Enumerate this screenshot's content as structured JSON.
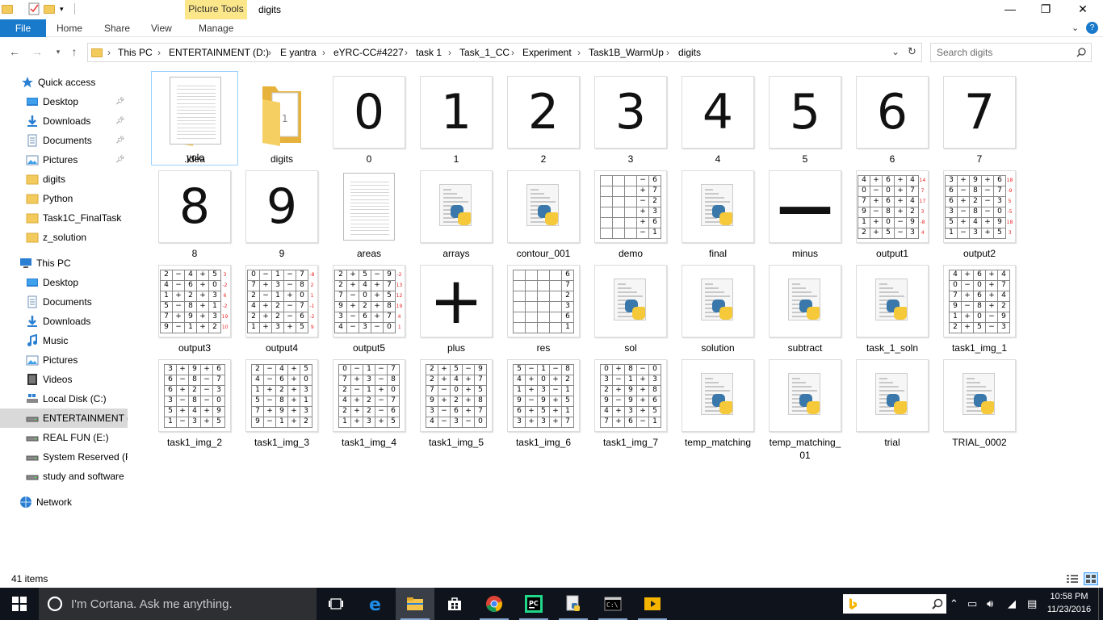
{
  "window": {
    "title": "digits",
    "contextual_tab_group": "Picture Tools",
    "controls": {
      "minimize": "—",
      "restore": "❐",
      "close": "✕"
    }
  },
  "ribbon": {
    "tabs": [
      "File",
      "Home",
      "Share",
      "View",
      "Manage"
    ],
    "help_chevron": "⌄",
    "help": "?"
  },
  "address_bar": {
    "breadcrumbs": [
      "This PC",
      "ENTERTAINMENT (D:)",
      "E yantra",
      "eYRC-CC#4227",
      "task 1",
      "Task_1_CC",
      "Experiment",
      "Task1B_WarmUp",
      "digits"
    ],
    "separator": "›"
  },
  "search": {
    "placeholder": "Search digits"
  },
  "navigation_pane": {
    "quick_access_label": "Quick access",
    "quick_access": [
      {
        "label": "Desktop",
        "icon": "desktop-icon",
        "pinned": true
      },
      {
        "label": "Downloads",
        "icon": "downloads-icon",
        "pinned": true
      },
      {
        "label": "Documents",
        "icon": "documents-icon",
        "pinned": true
      },
      {
        "label": "Pictures",
        "icon": "pictures-icon",
        "pinned": true
      },
      {
        "label": "digits",
        "icon": "folder-icon",
        "pinned": false
      },
      {
        "label": "Python",
        "icon": "folder-icon",
        "pinned": false
      },
      {
        "label": "Task1C_FinalTask",
        "icon": "folder-icon",
        "pinned": false
      },
      {
        "label": "z_solution",
        "icon": "folder-icon",
        "pinned": false
      }
    ],
    "this_pc_label": "This PC",
    "this_pc": [
      {
        "label": "Desktop",
        "icon": "desktop-icon"
      },
      {
        "label": "Documents",
        "icon": "documents-icon"
      },
      {
        "label": "Downloads",
        "icon": "downloads-icon"
      },
      {
        "label": "Music",
        "icon": "music-icon"
      },
      {
        "label": "Pictures",
        "icon": "pictures-icon"
      },
      {
        "label": "Videos",
        "icon": "videos-icon"
      },
      {
        "label": "Local Disk (C:)",
        "icon": "windows-drive-icon"
      },
      {
        "label": "ENTERTAINMENT (D:)",
        "icon": "drive-icon",
        "selected": true
      },
      {
        "label": "REAL FUN (E:)",
        "icon": "drive-icon"
      },
      {
        "label": "System Reserved (F:)",
        "icon": "drive-icon"
      },
      {
        "label": "study and software",
        "icon": "drive-icon"
      }
    ],
    "network_label": "Network"
  },
  "files": [
    {
      "name": ".idea",
      "kind": "folder"
    },
    {
      "name": "digits",
      "kind": "folder"
    },
    {
      "name": "0",
      "kind": "digit",
      "glyph": "0"
    },
    {
      "name": "1",
      "kind": "digit",
      "glyph": "1"
    },
    {
      "name": "2",
      "kind": "digit",
      "glyph": "2"
    },
    {
      "name": "3",
      "kind": "digit",
      "glyph": "3"
    },
    {
      "name": "4",
      "kind": "digit",
      "glyph": "4"
    },
    {
      "name": "5",
      "kind": "digit",
      "glyph": "5"
    },
    {
      "name": "6",
      "kind": "digit",
      "glyph": "6"
    },
    {
      "name": "7",
      "kind": "digit",
      "glyph": "7"
    },
    {
      "name": "8",
      "kind": "digit",
      "glyph": "8"
    },
    {
      "name": "9",
      "kind": "digit",
      "glyph": "9"
    },
    {
      "name": "areas",
      "kind": "doc"
    },
    {
      "name": "arrays",
      "kind": "py"
    },
    {
      "name": "contour_001",
      "kind": "py"
    },
    {
      "name": "demo",
      "kind": "grid",
      "rows": [
        [
          "",
          "",
          "",
          "−",
          "6"
        ],
        [
          "",
          "",
          "",
          "+",
          "7"
        ],
        [
          "",
          "",
          "",
          "−",
          "2"
        ],
        [
          "",
          "",
          "",
          "+",
          "3"
        ],
        [
          "",
          "",
          "",
          "+",
          "6"
        ],
        [
          "",
          "",
          "",
          "−",
          "1"
        ]
      ]
    },
    {
      "name": "final",
      "kind": "py"
    },
    {
      "name": "minus",
      "kind": "digit",
      "glyph": "—"
    },
    {
      "name": "output1",
      "kind": "grid",
      "rows": [
        [
          "4",
          "+",
          "6",
          "+",
          "4",
          "14"
        ],
        [
          "0",
          "−",
          "0",
          "+",
          "7",
          "7"
        ],
        [
          "7",
          "+",
          "6",
          "+",
          "4",
          "17"
        ],
        [
          "9",
          "−",
          "8",
          "+",
          "2",
          "3"
        ],
        [
          "1",
          "+",
          "0",
          "−",
          "9",
          "-8"
        ],
        [
          "2",
          "+",
          "5",
          "−",
          "3",
          "4"
        ]
      ]
    },
    {
      "name": "output2",
      "kind": "grid",
      "rows": [
        [
          "3",
          "+",
          "9",
          "+",
          "6",
          "18"
        ],
        [
          "6",
          "−",
          "8",
          "−",
          "7",
          "-9"
        ],
        [
          "6",
          "+",
          "2",
          "−",
          "3",
          "5"
        ],
        [
          "3",
          "−",
          "8",
          "−",
          "0",
          "-5"
        ],
        [
          "5",
          "+",
          "4",
          "+",
          "9",
          "18"
        ],
        [
          "1",
          "−",
          "3",
          "+",
          "5",
          "3"
        ]
      ]
    },
    {
      "name": "output3",
      "kind": "grid",
      "rows": [
        [
          "2",
          "−",
          "4",
          "+",
          "5",
          "3"
        ],
        [
          "4",
          "−",
          "6",
          "+",
          "0",
          "-2"
        ],
        [
          "1",
          "+",
          "2",
          "+",
          "3",
          "6"
        ],
        [
          "5",
          "−",
          "8",
          "+",
          "1",
          "-2"
        ],
        [
          "7",
          "+",
          "9",
          "+",
          "3",
          "19"
        ],
        [
          "9",
          "−",
          "1",
          "+",
          "2",
          "10"
        ]
      ]
    },
    {
      "name": "output4",
      "kind": "grid",
      "rows": [
        [
          "0",
          "−",
          "1",
          "−",
          "7",
          "-8"
        ],
        [
          "7",
          "+",
          "3",
          "−",
          "8",
          "2"
        ],
        [
          "2",
          "−",
          "1",
          "+",
          "0",
          "1"
        ],
        [
          "4",
          "+",
          "2",
          "−",
          "7",
          "-1"
        ],
        [
          "2",
          "+",
          "2",
          "−",
          "6",
          "-2"
        ],
        [
          "1",
          "+",
          "3",
          "+",
          "5",
          "9"
        ]
      ]
    },
    {
      "name": "output5",
      "kind": "grid",
      "rows": [
        [
          "2",
          "+",
          "5",
          "−",
          "9",
          "-2"
        ],
        [
          "2",
          "+",
          "4",
          "+",
          "7",
          "13"
        ],
        [
          "7",
          "−",
          "0",
          "+",
          "5",
          "12"
        ],
        [
          "9",
          "+",
          "2",
          "+",
          "8",
          "19"
        ],
        [
          "3",
          "−",
          "6",
          "+",
          "7",
          "4"
        ],
        [
          "4",
          "−",
          "3",
          "−",
          "0",
          "1"
        ]
      ]
    },
    {
      "name": "plus",
      "kind": "digit",
      "glyph": "+"
    },
    {
      "name": "res",
      "kind": "grid",
      "rows": [
        [
          "",
          "",
          "",
          "",
          "6"
        ],
        [
          "",
          "",
          "",
          "",
          "7"
        ],
        [
          "",
          "",
          "",
          "",
          "2"
        ],
        [
          "",
          "",
          "",
          "",
          "3"
        ],
        [
          "",
          "",
          "",
          "",
          "6"
        ],
        [
          "",
          "",
          "",
          "",
          "1"
        ]
      ]
    },
    {
      "name": "sol",
      "kind": "py"
    },
    {
      "name": "solution",
      "kind": "py"
    },
    {
      "name": "subtract",
      "kind": "py"
    },
    {
      "name": "task_1_soln",
      "kind": "py"
    },
    {
      "name": "task1_img_1",
      "kind": "grid",
      "rows": [
        [
          "4",
          "+",
          "6",
          "+",
          "4"
        ],
        [
          "0",
          "−",
          "0",
          "+",
          "7"
        ],
        [
          "7",
          "+",
          "6",
          "+",
          "4"
        ],
        [
          "9",
          "−",
          "8",
          "+",
          "2"
        ],
        [
          "1",
          "+",
          "0",
          "−",
          "9"
        ],
        [
          "2",
          "+",
          "5",
          "−",
          "3"
        ]
      ]
    },
    {
      "name": "task1_img_2",
      "kind": "grid",
      "rows": [
        [
          "3",
          "+",
          "9",
          "+",
          "6"
        ],
        [
          "6",
          "−",
          "8",
          "−",
          "7"
        ],
        [
          "6",
          "+",
          "2",
          "−",
          "3"
        ],
        [
          "3",
          "−",
          "8",
          "−",
          "0"
        ],
        [
          "5",
          "+",
          "4",
          "+",
          "9"
        ],
        [
          "1",
          "−",
          "3",
          "+",
          "5"
        ]
      ]
    },
    {
      "name": "task1_img_3",
      "kind": "grid",
      "rows": [
        [
          "2",
          "−",
          "4",
          "+",
          "5"
        ],
        [
          "4",
          "−",
          "6",
          "+",
          "0"
        ],
        [
          "1",
          "+",
          "2",
          "+",
          "3"
        ],
        [
          "5",
          "−",
          "8",
          "+",
          "1"
        ],
        [
          "7",
          "+",
          "9",
          "+",
          "3"
        ],
        [
          "9",
          "−",
          "1",
          "+",
          "2"
        ]
      ]
    },
    {
      "name": "task1_img_4",
      "kind": "grid",
      "rows": [
        [
          "0",
          "−",
          "1",
          "−",
          "7"
        ],
        [
          "7",
          "+",
          "3",
          "−",
          "8"
        ],
        [
          "2",
          "−",
          "1",
          "+",
          "0"
        ],
        [
          "4",
          "+",
          "2",
          "−",
          "7"
        ],
        [
          "2",
          "+",
          "2",
          "−",
          "6"
        ],
        [
          "1",
          "+",
          "3",
          "+",
          "5"
        ]
      ]
    },
    {
      "name": "task1_img_5",
      "kind": "grid",
      "rows": [
        [
          "2",
          "+",
          "5",
          "−",
          "9"
        ],
        [
          "2",
          "+",
          "4",
          "+",
          "7"
        ],
        [
          "7",
          "−",
          "0",
          "+",
          "5"
        ],
        [
          "9",
          "+",
          "2",
          "+",
          "8"
        ],
        [
          "3",
          "−",
          "6",
          "+",
          "7"
        ],
        [
          "4",
          "−",
          "3",
          "−",
          "0"
        ]
      ]
    },
    {
      "name": "task1_img_6",
      "kind": "grid",
      "rows": [
        [
          "5",
          "−",
          "1",
          "−",
          "8"
        ],
        [
          "4",
          "+",
          "0",
          "+",
          "2"
        ],
        [
          "1",
          "+",
          "3",
          "−",
          "1"
        ],
        [
          "9",
          "−",
          "9",
          "+",
          "5"
        ],
        [
          "6",
          "+",
          "5",
          "+",
          "1"
        ],
        [
          "3",
          "+",
          "3",
          "+",
          "7"
        ]
      ]
    },
    {
      "name": "task1_img_7",
      "kind": "grid",
      "rows": [
        [
          "0",
          "+",
          "8",
          "−",
          "0"
        ],
        [
          "3",
          "−",
          "1",
          "+",
          "3"
        ],
        [
          "2",
          "+",
          "9",
          "+",
          "8"
        ],
        [
          "9",
          "−",
          "9",
          "+",
          "6"
        ],
        [
          "4",
          "+",
          "3",
          "+",
          "5"
        ],
        [
          "7",
          "+",
          "6",
          "−",
          "1"
        ]
      ]
    },
    {
      "name": "temp_matching",
      "kind": "py"
    },
    {
      "name": "temp_matching_01",
      "kind": "py"
    },
    {
      "name": "trial",
      "kind": "py"
    },
    {
      "name": "TRIAL_0002",
      "kind": "py"
    },
    {
      "name": "yolo",
      "kind": "doc",
      "selected": true
    }
  ],
  "status": {
    "item_count": "41 items"
  },
  "taskbar": {
    "cortana_placeholder": "I'm Cortana. Ask me anything.",
    "apps": [
      "task-view-icon",
      "edge-icon",
      "file-explorer-icon",
      "store-icon",
      "chrome-icon",
      "pycharm-icon",
      "python-file-icon",
      "cmd-icon",
      "media-player-icon"
    ],
    "time": "10:58 PM",
    "date": "11/23/2016"
  },
  "colors": {
    "accent": "#1979ca",
    "contextual": "#fce68a",
    "selection": "#cce8ff",
    "taskbar": "#0e131c"
  }
}
